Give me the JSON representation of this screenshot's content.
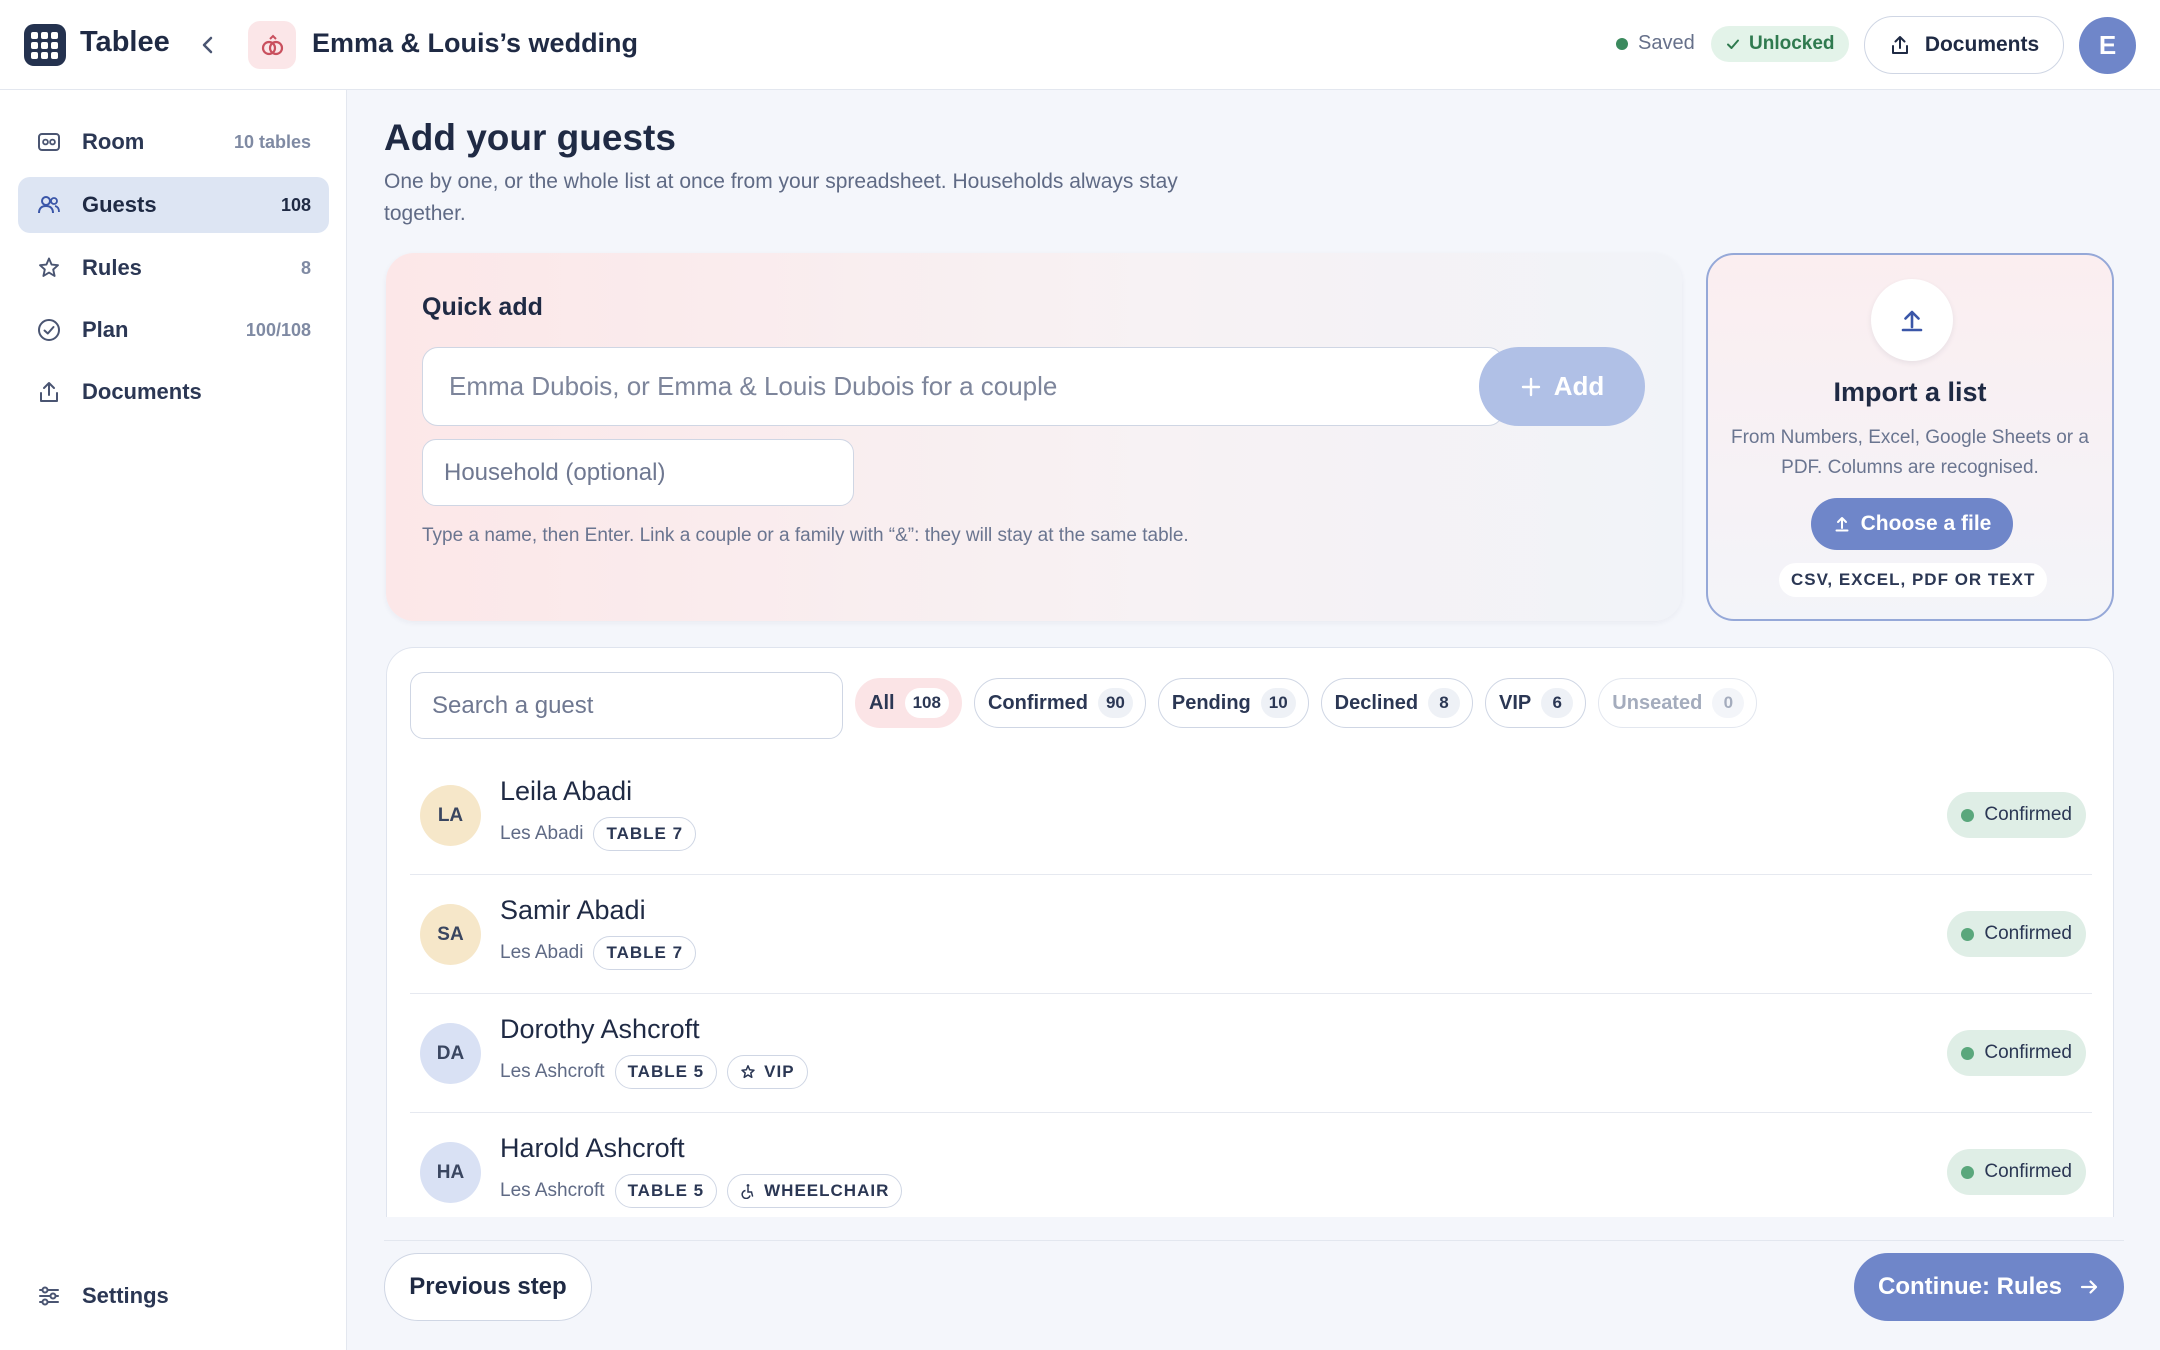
{
  "app": {
    "name": "Tablee"
  },
  "header": {
    "event_title": "Emma & Louis’s wedding",
    "saved_label": "Saved",
    "unlocked_label": "Unlocked",
    "documents_label": "Documents",
    "avatar_initial": "E"
  },
  "sidebar": {
    "items": [
      {
        "label": "Room",
        "count": "10 tables",
        "icon": "room-icon"
      },
      {
        "label": "Guests",
        "count": "108",
        "icon": "users-icon",
        "active": true
      },
      {
        "label": "Rules",
        "count": "8",
        "icon": "star-icon"
      },
      {
        "label": "Plan",
        "count": "100/108",
        "icon": "check-circle-icon"
      },
      {
        "label": "Documents",
        "count": "",
        "icon": "upload-icon"
      }
    ],
    "settings_label": "Settings"
  },
  "main": {
    "title": "Add your guests",
    "subtitle": "One by one, or the whole list at once from your spreadsheet. Households always stay together."
  },
  "quick_add": {
    "title": "Quick add",
    "name_placeholder": "Emma Dubois, or Emma & Louis Dubois for a couple",
    "add_label": "Add",
    "household_placeholder": "Household (optional)",
    "hint": "Type a name, then Enter. Link a couple or a family with “&”: they will stay at the same table."
  },
  "import": {
    "title": "Import a list",
    "description": "From Numbers, Excel, Google Sheets or a PDF. Columns are recognised.",
    "choose_label": "Choose a file",
    "formats": "CSV, EXCEL, PDF OR TEXT"
  },
  "guests": {
    "search_placeholder": "Search a guest",
    "filters": [
      {
        "label": "All",
        "count": "108"
      },
      {
        "label": "Confirmed",
        "count": "90"
      },
      {
        "label": "Pending",
        "count": "10"
      },
      {
        "label": "Declined",
        "count": "8"
      },
      {
        "label": "VIP",
        "count": "6"
      },
      {
        "label": "Unseated",
        "count": "0"
      }
    ],
    "rows": [
      {
        "initials": "LA",
        "name": "Leila Abadi",
        "household": "Les Abadi",
        "table": "TABLE 7",
        "tag": "",
        "status": "Confirmed"
      },
      {
        "initials": "SA",
        "name": "Samir Abadi",
        "household": "Les Abadi",
        "table": "TABLE 7",
        "tag": "",
        "status": "Confirmed"
      },
      {
        "initials": "DA",
        "name": "Dorothy Ashcroft",
        "household": "Les Ashcroft",
        "table": "TABLE 5",
        "tag": "VIP",
        "status": "Confirmed"
      },
      {
        "initials": "HA",
        "name": "Harold Ashcroft",
        "household": "Les Ashcroft",
        "table": "TABLE 5",
        "tag": "WHEELCHAIR",
        "status": "Confirmed"
      }
    ]
  },
  "footer": {
    "previous_label": "Previous step",
    "continue_label": "Continue: Rules"
  },
  "colors": {
    "brand_dark": "#24324f",
    "accent": "#6f86c9",
    "accent_light": "#b0c0e6",
    "success": "#5aa77c",
    "rose": "#fbe4e6"
  }
}
